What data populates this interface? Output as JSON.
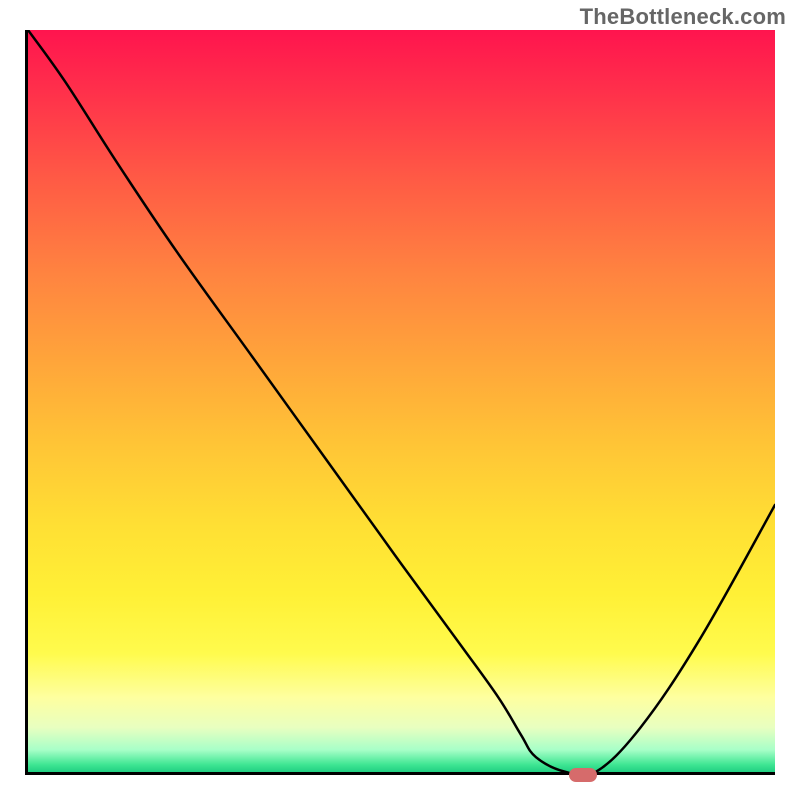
{
  "watermark": "TheBottleneck.com",
  "chart_data": {
    "type": "line",
    "title": "",
    "xlabel": "",
    "ylabel": "",
    "xlim": [
      0,
      100
    ],
    "ylim": [
      0,
      100
    ],
    "x": [
      0,
      5,
      12,
      20,
      30,
      40,
      50,
      58,
      63,
      66,
      68,
      72,
      76,
      82,
      90,
      100
    ],
    "values": [
      100,
      93,
      82,
      70,
      56,
      42,
      28,
      17,
      10,
      5,
      2,
      0,
      0,
      6,
      18,
      36
    ],
    "optimal_point": {
      "x": 74,
      "y": 0
    },
    "gradient": {
      "top_color": "#ff144e",
      "bottom_color": "#21cf82",
      "description": "vertical red-to-green through orange/yellow"
    },
    "marker_color": "#d66b6b"
  }
}
